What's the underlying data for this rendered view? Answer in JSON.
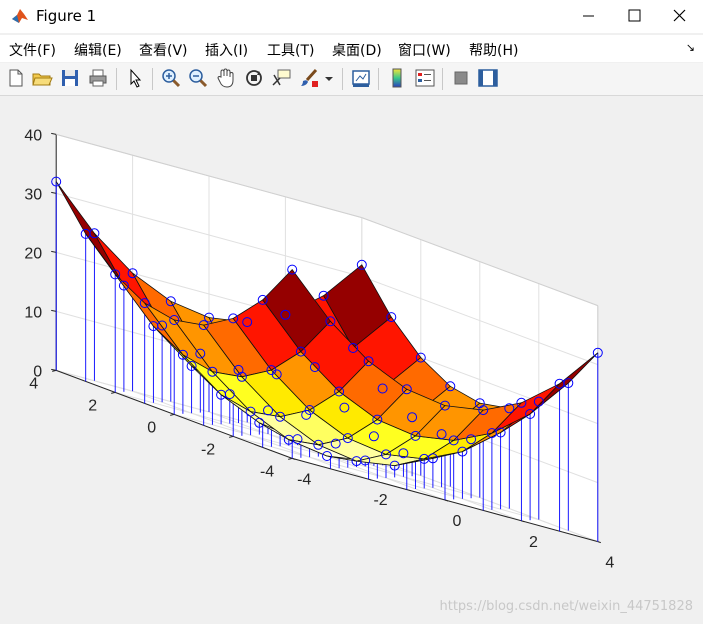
{
  "window": {
    "title": "Figure 1"
  },
  "menu": [
    "文件(F)",
    "编辑(E)",
    "查看(V)",
    "插入(I)",
    "工具(T)",
    "桌面(D)",
    "窗口(W)",
    "帮助(H)"
  ],
  "toolbar": [
    "new-figure-icon",
    "open-icon",
    "save-icon",
    "print-icon",
    "pointer-icon",
    "zoom-in-icon",
    "zoom-out-icon",
    "pan-icon",
    "rotate-3d-icon",
    "data-cursor-icon",
    "brush-icon",
    "brush-dropdown-icon",
    "link-plot-icon",
    "colorbar-icon",
    "legend-icon",
    "hide-plot-tools-icon",
    "show-plot-tools-icon"
  ],
  "chart_data": {
    "type": "surface+stem3",
    "title": "",
    "x": [
      -4,
      -3,
      -2,
      -1,
      0,
      1,
      2,
      3,
      4
    ],
    "y": [
      -4,
      -3,
      -2,
      -1,
      0,
      1,
      2,
      3,
      4
    ],
    "z_formula": "Z = X^2 + Y^2",
    "zlim": [
      0,
      40
    ],
    "ztick_labels": [
      "0",
      "10",
      "20",
      "30",
      "40"
    ],
    "xtick_labels": [
      "-4",
      "-2",
      "0",
      "2",
      "4"
    ],
    "ytick_labels": [
      "-4",
      "-2",
      "0",
      "2",
      "4"
    ],
    "colormap": "hot",
    "stem_color": "#0000ff",
    "marker": "circle",
    "grid": true
  },
  "watermark": "https://blog.csdn.net/weixin_44751828"
}
